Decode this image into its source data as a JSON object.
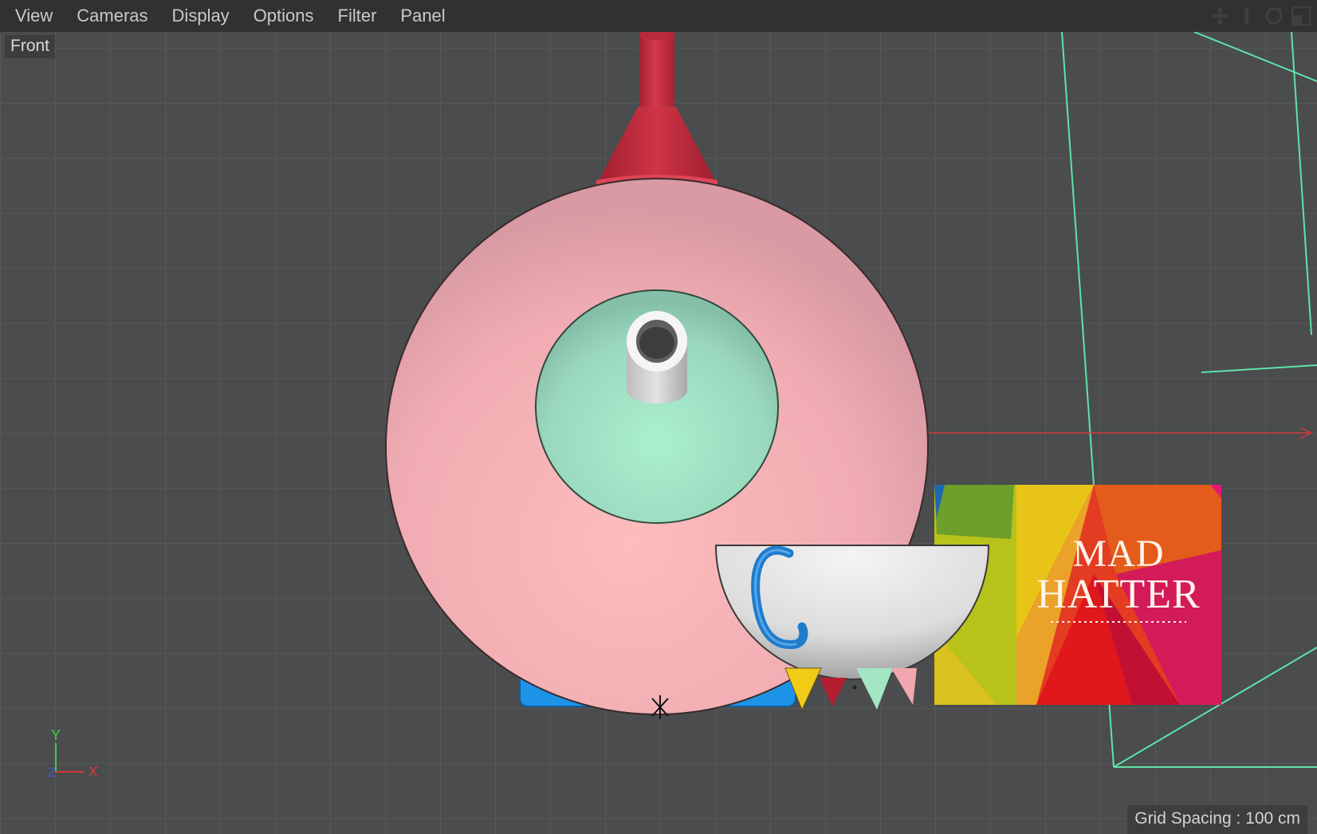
{
  "menu": {
    "items": [
      {
        "id": "view",
        "label": "View"
      },
      {
        "id": "cameras",
        "label": "Cameras"
      },
      {
        "id": "display",
        "label": "Display"
      },
      {
        "id": "options",
        "label": "Options"
      },
      {
        "id": "filter",
        "label": "Filter"
      },
      {
        "id": "panel",
        "label": "Panel"
      }
    ]
  },
  "nav_icons": [
    "move-icon",
    "dolly-icon",
    "rotate-icon",
    "maximize-icon"
  ],
  "viewport": {
    "view_label": "Front",
    "grid_spacing": "Grid Spacing : 100 cm"
  },
  "poster": {
    "line1": "MAD",
    "line2": "HATTER"
  },
  "axis": {
    "y": "Y",
    "x": "X",
    "z": "Z"
  },
  "colors": {
    "menubar": "#2f3133",
    "viewport_bg": "#4a4c4e",
    "grid_line": "#555759",
    "teapot_body": "#f3b3b6",
    "teapot_lid": "#a7e8c9",
    "spout_cone": "#c42a3c",
    "base_plate": "#1d94e8",
    "cup": "#e6e6e6",
    "cup_handle": "#1e7ccc",
    "camera_frustum": "#5fe3a8",
    "x_axis": "#d13a3a",
    "y_axis": "#3bd13b",
    "z_axis": "#3a5ad1"
  }
}
